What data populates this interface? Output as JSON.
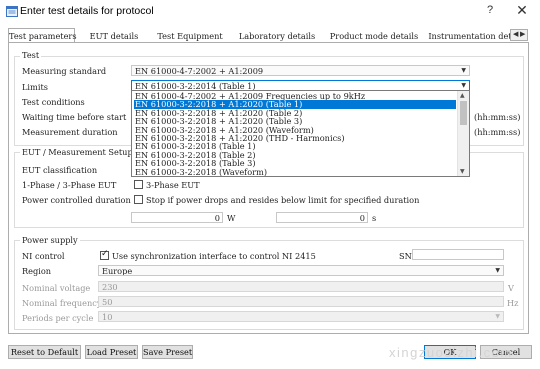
{
  "window": {
    "title": "Enter test details for protocol",
    "help_glyph": "?",
    "close_glyph": "✕"
  },
  "tabs": [
    {
      "label": "Test parameters"
    },
    {
      "label": "EUT details"
    },
    {
      "label": "Test Equipment"
    },
    {
      "label": "Laboratory details"
    },
    {
      "label": "Product mode details"
    },
    {
      "label": "Instrumentation det"
    }
  ],
  "test": {
    "group_title": "Test",
    "measuring_standard_label": "Measuring standard",
    "measuring_standard_value": "EN 61000-4-7:2002 + A1:2009",
    "limits_label": "Limits",
    "limits_value": "EN 61000-3-2:2014 (Table 1)",
    "test_conditions_label": "Test conditions",
    "waiting_time_label": "Waiting time before start",
    "measurement_duration_label": "Measurement duration",
    "waiting_time_unit": "(hh:mm:ss)",
    "measurement_duration_unit": "(hh:mm:ss)"
  },
  "limits_options": [
    "EN 61000-4-7:2002 + A1:2009 Frequencies up to 9kHz",
    "EN 61000-3-2:2018 + A1:2020 (Table 1)",
    "EN 61000-3-2:2018 + A1:2020 (Table 2)",
    "EN 61000-3-2:2018 + A1:2020 (Table 3)",
    "EN 61000-3-2:2018 + A1:2020 (Waveform)",
    "EN 61000-3-2:2018 + A1:2020 (THD - Harmonics)",
    "EN 61000-3-2:2018 (Table 1)",
    "EN 61000-3-2:2018 (Table 2)",
    "EN 61000-3-2:2018 (Table 3)",
    "EN 61000-3-2:2018 (Waveform)"
  ],
  "limits_selected_index": 1,
  "eut": {
    "group_title": "EUT / Measurement Setup",
    "classification_label": "EUT classification",
    "phase_label": "1-Phase / 3-Phase EUT",
    "three_phase_checkbox_label": "3-Phase EUT",
    "three_phase_checked": false,
    "power_controlled_label": "Power controlled duration",
    "stop_checkbox_label": "Stop if power drops and resides below limit for specified duration",
    "stop_checked": false,
    "power_value": "0",
    "power_unit": "W",
    "duration_value": "0",
    "duration_unit": "s"
  },
  "power_supply": {
    "group_title": "Power supply",
    "ni_control_label": "NI control",
    "sync_checkbox_label": "Use synchronization interface to control NI 2415",
    "sync_checked": true,
    "sn_label": "SN",
    "sn_value": "",
    "region_label": "Region",
    "region_value": "Europe",
    "nominal_voltage_label": "Nominal voltage",
    "nominal_voltage_value": "230",
    "nominal_voltage_unit": "V",
    "nominal_frequency_label": "Nominal frequency",
    "nominal_frequency_value": "50",
    "nominal_frequency_unit": "Hz",
    "periods_label": "Periods per cycle",
    "periods_value": "10"
  },
  "buttons": {
    "reset": "Reset to Default",
    "load": "Load Preset",
    "save": "Save Preset",
    "ok": "OK",
    "cancel": "Cancel"
  },
  "watermark": "xingzuodizhi.com",
  "icons": {
    "app": "protocol-window-icon",
    "dropdown_arrow": "chevron-down-icon"
  },
  "colors": {
    "selection": "#0078d7",
    "border": "#adadad"
  }
}
